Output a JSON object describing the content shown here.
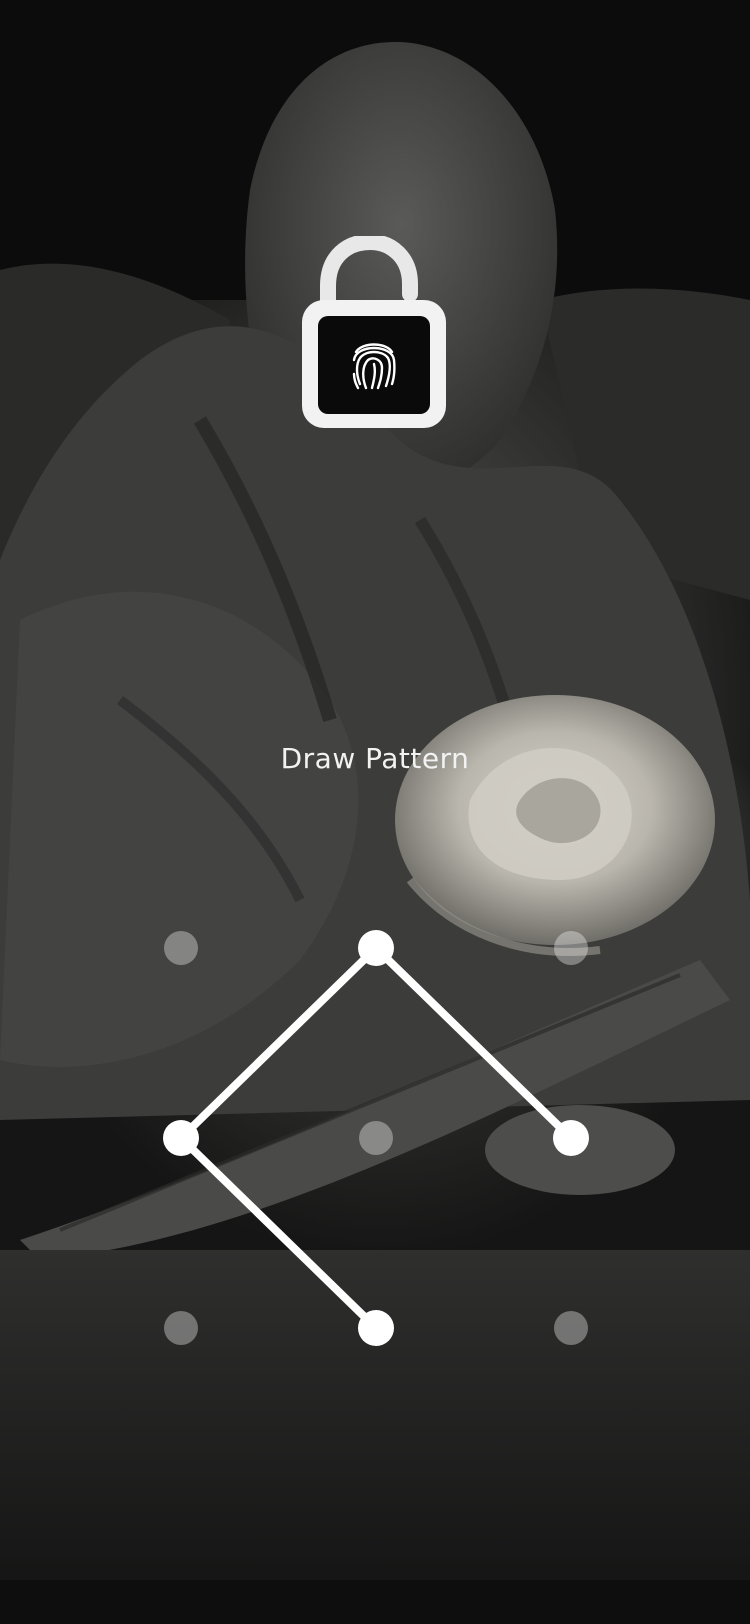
{
  "screen": {
    "prompt": "Draw Pattern"
  },
  "lock_icon": {
    "name": "unlocked-padlock-fingerprint-icon",
    "body_color": "#0a0a0a",
    "rim_color": "#ffffff"
  },
  "pattern": {
    "grid": [
      [
        {
          "id": "dot-1",
          "selected": false
        },
        {
          "id": "dot-2",
          "selected": true
        },
        {
          "id": "dot-3",
          "selected": false
        }
      ],
      [
        {
          "id": "dot-4",
          "selected": true
        },
        {
          "id": "dot-5",
          "selected": false
        },
        {
          "id": "dot-6",
          "selected": true
        }
      ],
      [
        {
          "id": "dot-7",
          "selected": false
        },
        {
          "id": "dot-8",
          "selected": true
        },
        {
          "id": "dot-9",
          "selected": false
        }
      ]
    ],
    "path_order": [
      8,
      4,
      2,
      6
    ],
    "line_color": "#ffffff",
    "inactive_dot_color": "rgba(255,255,255,0.35)"
  }
}
